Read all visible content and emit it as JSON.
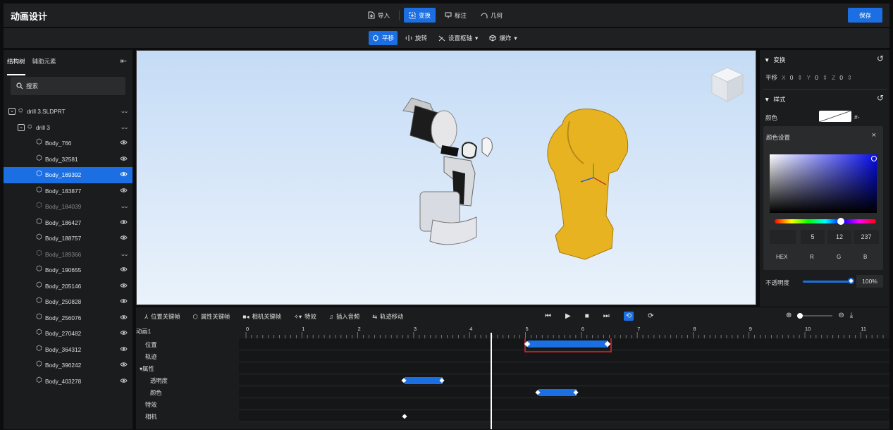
{
  "app": {
    "title": "动画设计",
    "save_label": "保存"
  },
  "toolbar": {
    "import": "导入",
    "transform": "变换",
    "annotate": "标注",
    "geometry": "几何"
  },
  "subtoolbar": {
    "translate": "平移",
    "rotate": "旋转",
    "set_axis": "设置枢轴",
    "explode": "爆炸"
  },
  "left": {
    "tab_tree": "结构树",
    "tab_aux": "辅助元素",
    "search_placeholder": "搜索",
    "items": [
      {
        "label": "drill 3.SLDPRT",
        "level": 0,
        "hidden": true
      },
      {
        "label": "drill 3",
        "level": 1,
        "hidden": true
      },
      {
        "label": "Body_766",
        "level": 2
      },
      {
        "label": "Body_32581",
        "level": 2
      },
      {
        "label": "Body_169392",
        "level": 2,
        "selected": true
      },
      {
        "label": "Body_183877",
        "level": 2
      },
      {
        "label": "Body_184039",
        "level": 2,
        "hidden": true
      },
      {
        "label": "Body_186427",
        "level": 2
      },
      {
        "label": "Body_188757",
        "level": 2
      },
      {
        "label": "Body_189366",
        "level": 2,
        "hidden": true
      },
      {
        "label": "Body_190655",
        "level": 2
      },
      {
        "label": "Body_205146",
        "level": 2
      },
      {
        "label": "Body_250828",
        "level": 2
      },
      {
        "label": "Body_256076",
        "level": 2
      },
      {
        "label": "Body_270482",
        "level": 2
      },
      {
        "label": "Body_364312",
        "level": 2
      },
      {
        "label": "Body_396242",
        "level": 2
      },
      {
        "label": "Body_403278",
        "level": 2
      }
    ]
  },
  "right": {
    "transform_title": "变换",
    "translate_label": "平移",
    "x_label": "X",
    "x_value": "0",
    "y_label": "Y",
    "y_value": "0",
    "z_label": "Z",
    "z_value": "0",
    "style_title": "样式",
    "color_label": "颜色",
    "color_hex_short": "#-",
    "color_popup_title": "颜色设置",
    "r_value": "5",
    "g_value": "12",
    "b_value": "237",
    "hex_label": "HEX",
    "r_label": "R",
    "g_label": "G",
    "b_label": "B",
    "opacity_label": "不透明度",
    "opacity_value": "100%"
  },
  "timeline": {
    "pos_key": "位置关键帧",
    "prop_key": "属性关键帧",
    "cam_key": "相机关键帧",
    "effects": "特效",
    "insert_audio": "插入音频",
    "track_move": "轨迹移动",
    "anim_name": "动画1",
    "ticks": [
      "0",
      "1",
      "2",
      "3",
      "4",
      "5",
      "6",
      "7",
      "8",
      "9",
      "10",
      "11"
    ],
    "tracks": [
      "位置",
      "轨迹",
      "▾属性",
      "透明度",
      "颜色",
      "特效",
      "相机"
    ]
  },
  "colors": {
    "accent": "#1b6fe3",
    "drill_yellow": "#e8b321",
    "highlight_red": "#e0282a"
  }
}
